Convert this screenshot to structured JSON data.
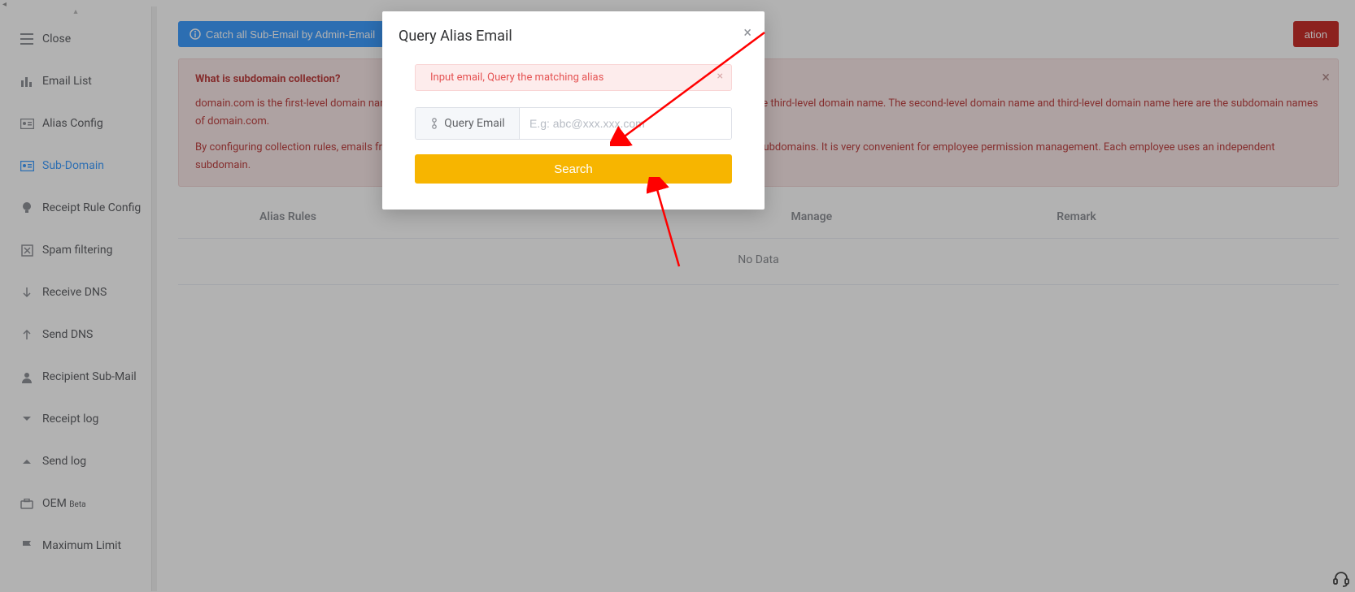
{
  "sidebar": {
    "items": [
      {
        "label": "Close"
      },
      {
        "label": "Email List"
      },
      {
        "label": "Alias Config"
      },
      {
        "label": "Sub-Domain"
      },
      {
        "label": "Receipt Rule Config"
      },
      {
        "label": "Spam filtering"
      },
      {
        "label": "Receive DNS"
      },
      {
        "label": "Send DNS"
      },
      {
        "label": "Recipient Sub-Mail"
      },
      {
        "label": "Receipt log"
      },
      {
        "label": "Send log"
      },
      {
        "label": "OEM ",
        "suffix": "Beta"
      },
      {
        "label": "Maximum Limit"
      }
    ]
  },
  "toolbar": {
    "catch_all_label": "Catch all Sub-Email by Admin-Email",
    "danger_suffix": "ation"
  },
  "alert": {
    "heading": "What is subdomain collection?",
    "p1": "domain.com is the first-level domain name, abc.domain.com is the second-level domain name, test.abc.domain.com is the third-level domain name. The second-level domain name and third-level domain name here are the subdomain names of domain.com.",
    "p2": "By configuring collection rules, emails from subdomains can be collected. A first-level domain name can have countless subdomains. It is very convenient for employee permission management. Each employee uses an independent subdomain."
  },
  "table": {
    "columns": {
      "alias": "Alias Rules",
      "manage": "Manage",
      "remark": "Remark"
    },
    "no_data": "No Data"
  },
  "modal": {
    "title": "Query Alias Email",
    "alert": "Input email, Query the matching alias",
    "addon_label": "Query Email",
    "placeholder": "E.g: abc@xxx.xxx.com",
    "search_label": "Search"
  }
}
